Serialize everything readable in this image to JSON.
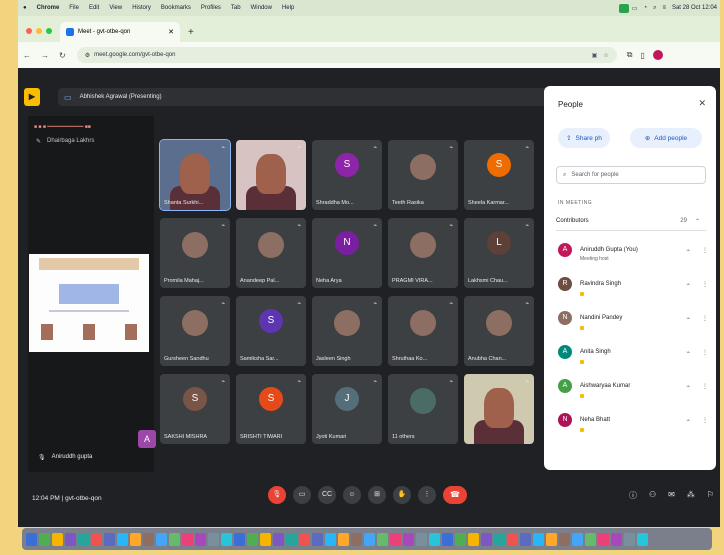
{
  "menubar": {
    "app": "Chrome",
    "items": [
      "File",
      "Edit",
      "View",
      "History",
      "Bookmarks",
      "Profiles",
      "Tab",
      "Window",
      "Help"
    ],
    "clock": "Sat 28 Oct 12:04"
  },
  "browser": {
    "tab_title": "Meet - gvt-otbe-qon",
    "new_tab": "+",
    "url": "meet.google.com/gvt-otbe-qon"
  },
  "meet": {
    "presenting_label": "Abhishek Agrawal (Presenting)",
    "presentation_owner": "Dhairbaga Lakhrs",
    "self_label": "Aniruddh gupta",
    "meeting_code": "gvt-otbe-qon",
    "time": "12:04 PM",
    "participants": [
      {
        "name": "Shanta Surkhi...",
        "kind": "video1"
      },
      {
        "name": "",
        "kind": "video2"
      },
      {
        "name": "Shraddha Mo...",
        "initial": "S",
        "color": "#8e24aa"
      },
      {
        "name": "Teeth Rasika",
        "kind": "photo"
      },
      {
        "name": "Sheela Karmar...",
        "initial": "S",
        "color": "#ef6c00"
      },
      {
        "name": "Promila Mahaj...",
        "kind": "photo"
      },
      {
        "name": "Anandeep Pal...",
        "kind": "photo"
      },
      {
        "name": "Neha Arya",
        "initial": "N",
        "color": "#7b1fa2"
      },
      {
        "name": "PRAGMI VIRA...",
        "kind": "photo"
      },
      {
        "name": "Lakhsmi Chau...",
        "initial": "L",
        "color": "#5d4037"
      },
      {
        "name": "Gursheen Sandhu",
        "kind": "photo"
      },
      {
        "name": "Samiksha Sar...",
        "initial": "S",
        "color": "#5e35b1"
      },
      {
        "name": "Jasleen Singh",
        "kind": "photo"
      },
      {
        "name": "Shruthaa Ko...",
        "kind": "photo"
      },
      {
        "name": "Anubha Chan...",
        "kind": "photo"
      },
      {
        "name": "SAKSHI MISHRA",
        "initial": "S",
        "color": "#795548"
      },
      {
        "name": "SRISHTI TIWARI",
        "initial": "S",
        "color": "#e64a19"
      },
      {
        "name": "Jyoti Kumari",
        "initial": "J",
        "color": "#546e7a"
      },
      {
        "name": "11 others",
        "kind": "others"
      },
      {
        "name": "",
        "kind": "video3"
      }
    ]
  },
  "people_panel": {
    "title": "People",
    "share_label": "Share ph",
    "add_people_label": "Add people",
    "search_placeholder": "Search for people",
    "in_meeting_label": "IN MEETING",
    "contributors_label": "Contributors",
    "contributors_count": "29",
    "people": [
      {
        "name": "Aniruddh Gupta (You)",
        "sub": "Meeting host",
        "initial": "A",
        "color": "#c2185b"
      },
      {
        "name": "Ravindra Singh",
        "sub": "",
        "initial": "R",
        "color": "#6d4c41"
      },
      {
        "name": "Nandini Pandey",
        "sub": "",
        "initial": "N",
        "color": "#8d6e63"
      },
      {
        "name": "Anita Singh",
        "sub": "",
        "initial": "A",
        "color": "#00897b"
      },
      {
        "name": "Aishwaryaa Kumar",
        "sub": "",
        "initial": "A",
        "color": "#43a047"
      },
      {
        "name": "Neha Bhatt",
        "sub": "",
        "initial": "N",
        "color": "#ad1457"
      }
    ]
  },
  "controls": {
    "end_call": "☎"
  }
}
